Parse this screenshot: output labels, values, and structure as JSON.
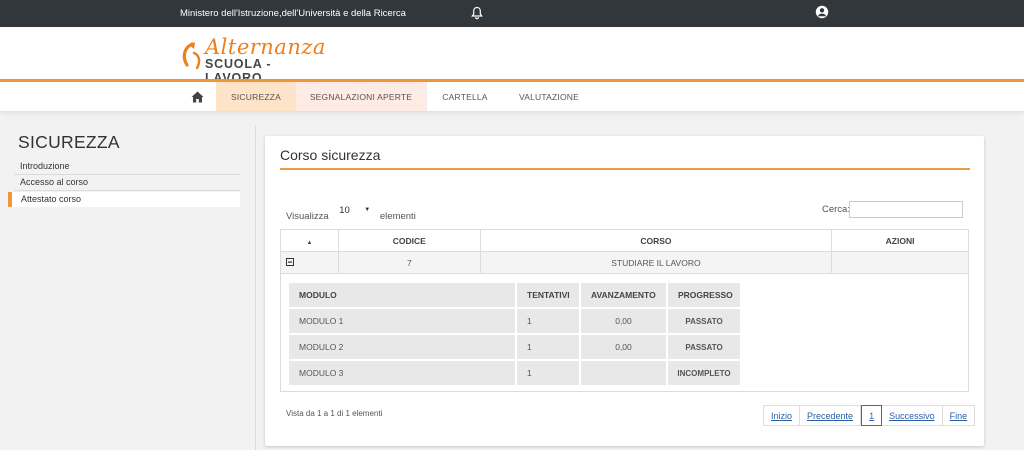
{
  "topbar": {
    "ministry": "Ministero dell'Istruzione,dell'Università e della Ricerca",
    "bell_icon": "bell-icon",
    "user_icon": "user-circle-icon"
  },
  "logo": {
    "line1": "Alternanza",
    "line2": "SCUOLA - LAVORO",
    "accent": "#ee7f1a"
  },
  "nav": {
    "home_icon": "home-icon",
    "items": [
      "SICUREZZA",
      "SEGNALAZIONI APERTE",
      "CARTELLA",
      "VALUTAZIONE"
    ]
  },
  "sidebar": {
    "title": "SICUREZZA",
    "links": [
      "Introduzione",
      "Accesso al corso",
      "Attestato corso"
    ]
  },
  "panel": {
    "title": "Corso sicurezza",
    "show_prefix": "Visualizza",
    "show_value": "10",
    "show_suffix": "elementi",
    "search_label": "Cerca:",
    "search_value": "",
    "columns": [
      "CODICE",
      "CORSO",
      "AZIONI"
    ],
    "row": {
      "expand_icon": "minus-square-icon",
      "codice": "7",
      "corso": "STUDIARE IL LAVORO",
      "azioni": ""
    },
    "sub_columns": [
      "MODULO",
      "TENTATIVI",
      "AVANZAMENTO",
      "PROGRESSO"
    ],
    "modules": [
      {
        "modulo": "MODULO 1",
        "tentativi": "1",
        "avanzamento": "0,00",
        "progresso": "PASSATO"
      },
      {
        "modulo": "MODULO 2",
        "tentativi": "1",
        "avanzamento": "0,00",
        "progresso": "PASSATO"
      },
      {
        "modulo": "MODULO 3",
        "tentativi": "1",
        "avanzamento": "",
        "progresso": "INCOMPLETO"
      }
    ],
    "info": "Vista da 1 a 1 di 1 elementi",
    "pager": {
      "first": "Inizio",
      "prev": "Precedente",
      "page": "1",
      "next": "Successivo",
      "last": "Fine"
    }
  }
}
